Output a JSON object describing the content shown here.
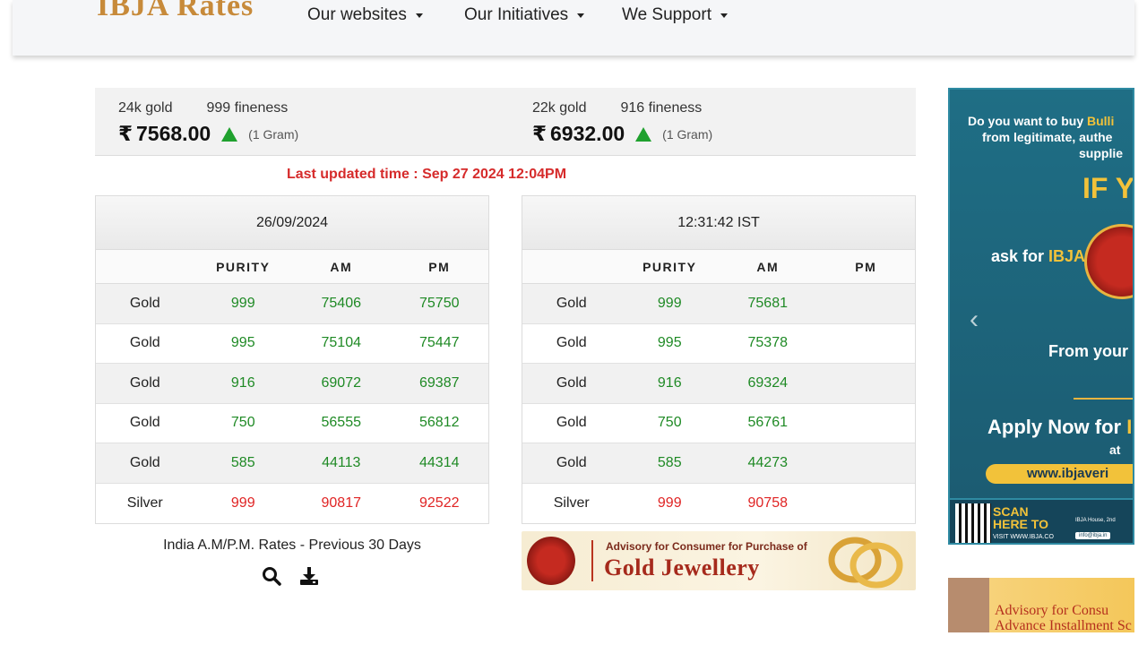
{
  "navbar": {
    "logo_text": "IBJA Rates",
    "items": [
      {
        "label": "Our websites"
      },
      {
        "label": "Our Initiatives"
      },
      {
        "label": "We Support"
      }
    ]
  },
  "prices": {
    "currency_symbol": "₹",
    "gold24": {
      "label": "24k gold",
      "fineness": "999 fineness",
      "value": "7568.00",
      "unit": "(1 Gram)",
      "trend": "up"
    },
    "gold22": {
      "label": "22k gold",
      "fineness": "916 fineness",
      "value": "6932.00",
      "unit": "(1 Gram)",
      "trend": "up"
    }
  },
  "last_updated": "Last updated time : Sep 27 2024 12:04PM",
  "table_left": {
    "heading": "26/09/2024",
    "columns": [
      "",
      "PURITY",
      "AM",
      "PM"
    ],
    "rows": [
      {
        "metal": "Gold",
        "purity": "999",
        "am": "75406",
        "pm": "75750"
      },
      {
        "metal": "Gold",
        "purity": "995",
        "am": "75104",
        "pm": "75447"
      },
      {
        "metal": "Gold",
        "purity": "916",
        "am": "69072",
        "pm": "69387"
      },
      {
        "metal": "Gold",
        "purity": "750",
        "am": "56555",
        "pm": "56812"
      },
      {
        "metal": "Gold",
        "purity": "585",
        "am": "44113",
        "pm": "44314"
      },
      {
        "metal": "Silver",
        "purity": "999",
        "am": "90817",
        "pm": "92522"
      }
    ]
  },
  "table_right": {
    "heading": "12:31:42 IST",
    "columns": [
      "",
      "PURITY",
      "AM",
      "PM"
    ],
    "rows": [
      {
        "metal": "Gold",
        "purity": "999",
        "am": "75681",
        "pm": ""
      },
      {
        "metal": "Gold",
        "purity": "995",
        "am": "75378",
        "pm": ""
      },
      {
        "metal": "Gold",
        "purity": "916",
        "am": "69324",
        "pm": ""
      },
      {
        "metal": "Gold",
        "purity": "750",
        "am": "56761",
        "pm": ""
      },
      {
        "metal": "Gold",
        "purity": "585",
        "am": "44273",
        "pm": ""
      },
      {
        "metal": "Silver",
        "purity": "999",
        "am": "90758",
        "pm": ""
      }
    ]
  },
  "previous_rates": {
    "label": "India A.M/P.M. Rates - Previous 30 Days",
    "icons": [
      "search-icon",
      "download-icon"
    ]
  },
  "advisory_banner": {
    "top_text": "Advisory for Consumer for Purchase of",
    "main_text": "Gold Jewellery"
  },
  "side_ad": {
    "line1a": "Do you want to buy ",
    "line1b": "Bulli",
    "line2": "from legitimate, authe",
    "line3": "supplie",
    "if_text": "IF YE",
    "ask_a": "ask for ",
    "ask_b": "IBJA",
    "from_text": "From your",
    "apply_a": "Apply Now for ",
    "apply_b": "IBJ",
    "at_text": "at",
    "url_text": "www.ibjaveri",
    "scan_text": "SCAN",
    "here_text": "HERE TO",
    "visit_text": "VISIT WWW.IBJA.CO",
    "address_text": "IBJA House, 2nd",
    "email_text": "info@ibja.in"
  },
  "bottom_ad": {
    "line1": "Advisory for Consu",
    "line2": "Advance Installment Sc"
  },
  "colors": {
    "up_green": "#1fa12e",
    "value_green": "#1f8a25",
    "value_red": "#e02424",
    "updated_red": "#d62b2b"
  }
}
